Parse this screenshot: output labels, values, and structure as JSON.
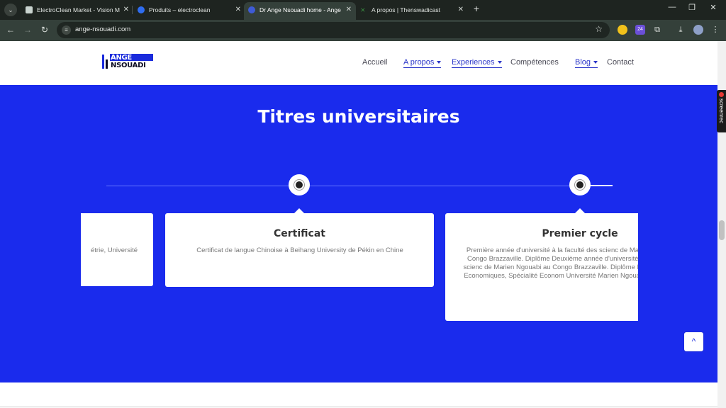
{
  "browser": {
    "tabs": [
      {
        "title": "ElectroClean Market - Vision M",
        "fav_color": "#c9d3cf"
      },
      {
        "title": "Produits – electroclean",
        "fav_color": "#2f6df0"
      },
      {
        "title": "Dr Ange Nsouadi home - Ange",
        "fav_color": "#3e5bd6"
      },
      {
        "title": "A propos | Thenswadicast",
        "fav_color": "#3c9a44"
      }
    ],
    "url": "ange-nsouadi.com",
    "new_tab_label": "+",
    "extension_badge": "24"
  },
  "site": {
    "logo": {
      "line1": "ANGE",
      "line2": "NSOUADI"
    },
    "nav": [
      {
        "label": "Accueil"
      },
      {
        "label": "A propos"
      },
      {
        "label": "Experiences"
      },
      {
        "label": "Compétences"
      },
      {
        "label": "Blog"
      },
      {
        "label": "Contact"
      }
    ],
    "section_title": "Titres universitaires",
    "cards": [
      {
        "title": "",
        "body": "étrie, Université"
      },
      {
        "title": "Certificat",
        "body": "Certificat de langue Chinoise à Beihang University de Pékin en Chine"
      },
      {
        "title": "Premier cycle",
        "body": "Première année d'université à la faculté des scienc de Marien Ngouabi au Congo Brazzaville. Diplôme Deuxième année d'université à la faculté des scienc de Marien Ngouabi au Congo Brazzaville. Diplôme Licence Sciences Economiques, Spécialité Econom Université Marien Ngouabi du Congo Bra"
      }
    ],
    "back_to_top": "^"
  },
  "overlay": {
    "screenrec_label": "screenrec"
  }
}
